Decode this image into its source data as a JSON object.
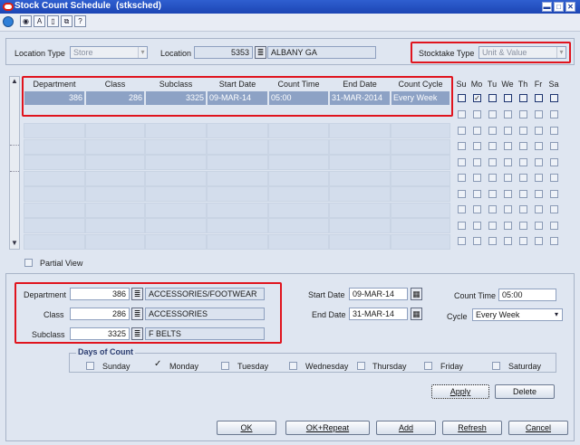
{
  "window": {
    "title": "Stock Count Schedule",
    "form_code": "(stksched)"
  },
  "header": {
    "location_type_label": "Location Type",
    "location_type_value": "Store",
    "location_label": "Location",
    "location_id": "5353",
    "location_name": "ALBANY GA",
    "stocktake_type_label": "Stocktake Type",
    "stocktake_type_value": "Unit & Value"
  },
  "grid": {
    "columns": [
      "Department",
      "Class",
      "Subclass",
      "Start Date",
      "Count Time",
      "End Date",
      "Count Cycle"
    ],
    "days": [
      "Su",
      "Mo",
      "Tu",
      "We",
      "Th",
      "Fr",
      "Sa"
    ],
    "rows": [
      {
        "department": "386",
        "class": "286",
        "subclass": "3325",
        "start_date": "09-MAR-14",
        "count_time": "05:00",
        "end_date": "31-MAR-2014",
        "count_cycle": "Every Week",
        "days_checked": [
          false,
          true,
          false,
          false,
          false,
          false,
          false
        ]
      }
    ]
  },
  "partial_view_label": "Partial View",
  "detail": {
    "department_label": "Department",
    "department_value": "386",
    "department_desc": "ACCESSORIES/FOOTWEAR",
    "class_label": "Class",
    "class_value": "286",
    "class_desc": "ACCESSORIES",
    "subclass_label": "Subclass",
    "subclass_value": "3325",
    "subclass_desc": "F BELTS",
    "start_date_label": "Start Date",
    "start_date_value": "09-MAR-14",
    "end_date_label": "End Date",
    "end_date_value": "31-MAR-14",
    "count_time_label": "Count Time",
    "count_time_value": "05:00",
    "cycle_label": "Cycle",
    "cycle_value": "Every Week"
  },
  "days_of_count": {
    "title": "Days of Count",
    "days": [
      {
        "label": "Sunday",
        "checked": false
      },
      {
        "label": "Monday",
        "checked": true
      },
      {
        "label": "Tuesday",
        "checked": false
      },
      {
        "label": "Wednesday",
        "checked": false
      },
      {
        "label": "Thursday",
        "checked": false
      },
      {
        "label": "Friday",
        "checked": false
      },
      {
        "label": "Saturday",
        "checked": false
      }
    ]
  },
  "buttons": {
    "apply": "Apply",
    "delete": "Delete",
    "ok": "OK",
    "ok_repeat": "OK+Repeat",
    "add": "Add",
    "refresh": "Refresh",
    "cancel": "Cancel"
  }
}
